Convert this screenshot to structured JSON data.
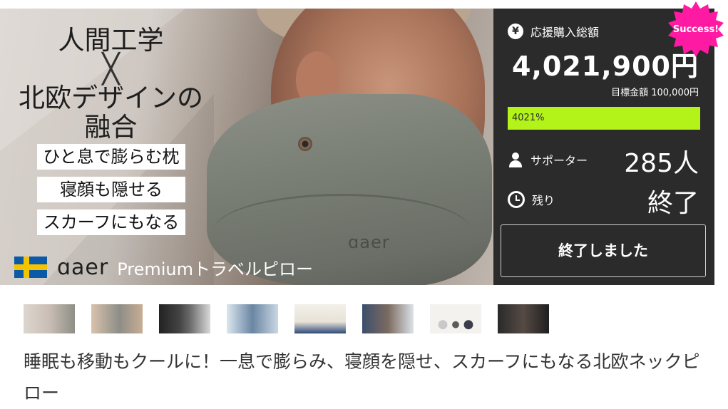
{
  "hero": {
    "heading_line1": "人間工学",
    "heading_cross": "╳",
    "heading_line2": "北欧デザインの",
    "heading_line3": "融合",
    "tags": [
      "ひと息で膨らむ枕",
      "寝顔も隠せる",
      "スカーフにもなる"
    ],
    "brand_logo": "ɑaer",
    "brand_sub": "Premiumトラベルピロー",
    "pillow_logo": "ɑaer"
  },
  "panel": {
    "amount_label": "応援購入総額",
    "amount": "4,021,900円",
    "goal": "目標金額 100,000円",
    "progress_text": "4021%",
    "progress_fraction": 1.0,
    "supporters_label": "サポーター",
    "supporters_value": "285人",
    "remaining_label": "残り",
    "remaining_value": "終了",
    "status_button": "終了しました",
    "success_badge": "Success!",
    "badge_color": "#ff1aa3",
    "progress_color": "#b3f31a",
    "panel_color": "#2b2b2b"
  },
  "icons": {
    "yen": "¥",
    "supporters": "user-icon",
    "remaining": "clock-icon"
  },
  "title": "睡眠も移動もクールに！一息で膨らみ、寝顔を隠せ、スカーフにもなる北欧ネックピロー"
}
